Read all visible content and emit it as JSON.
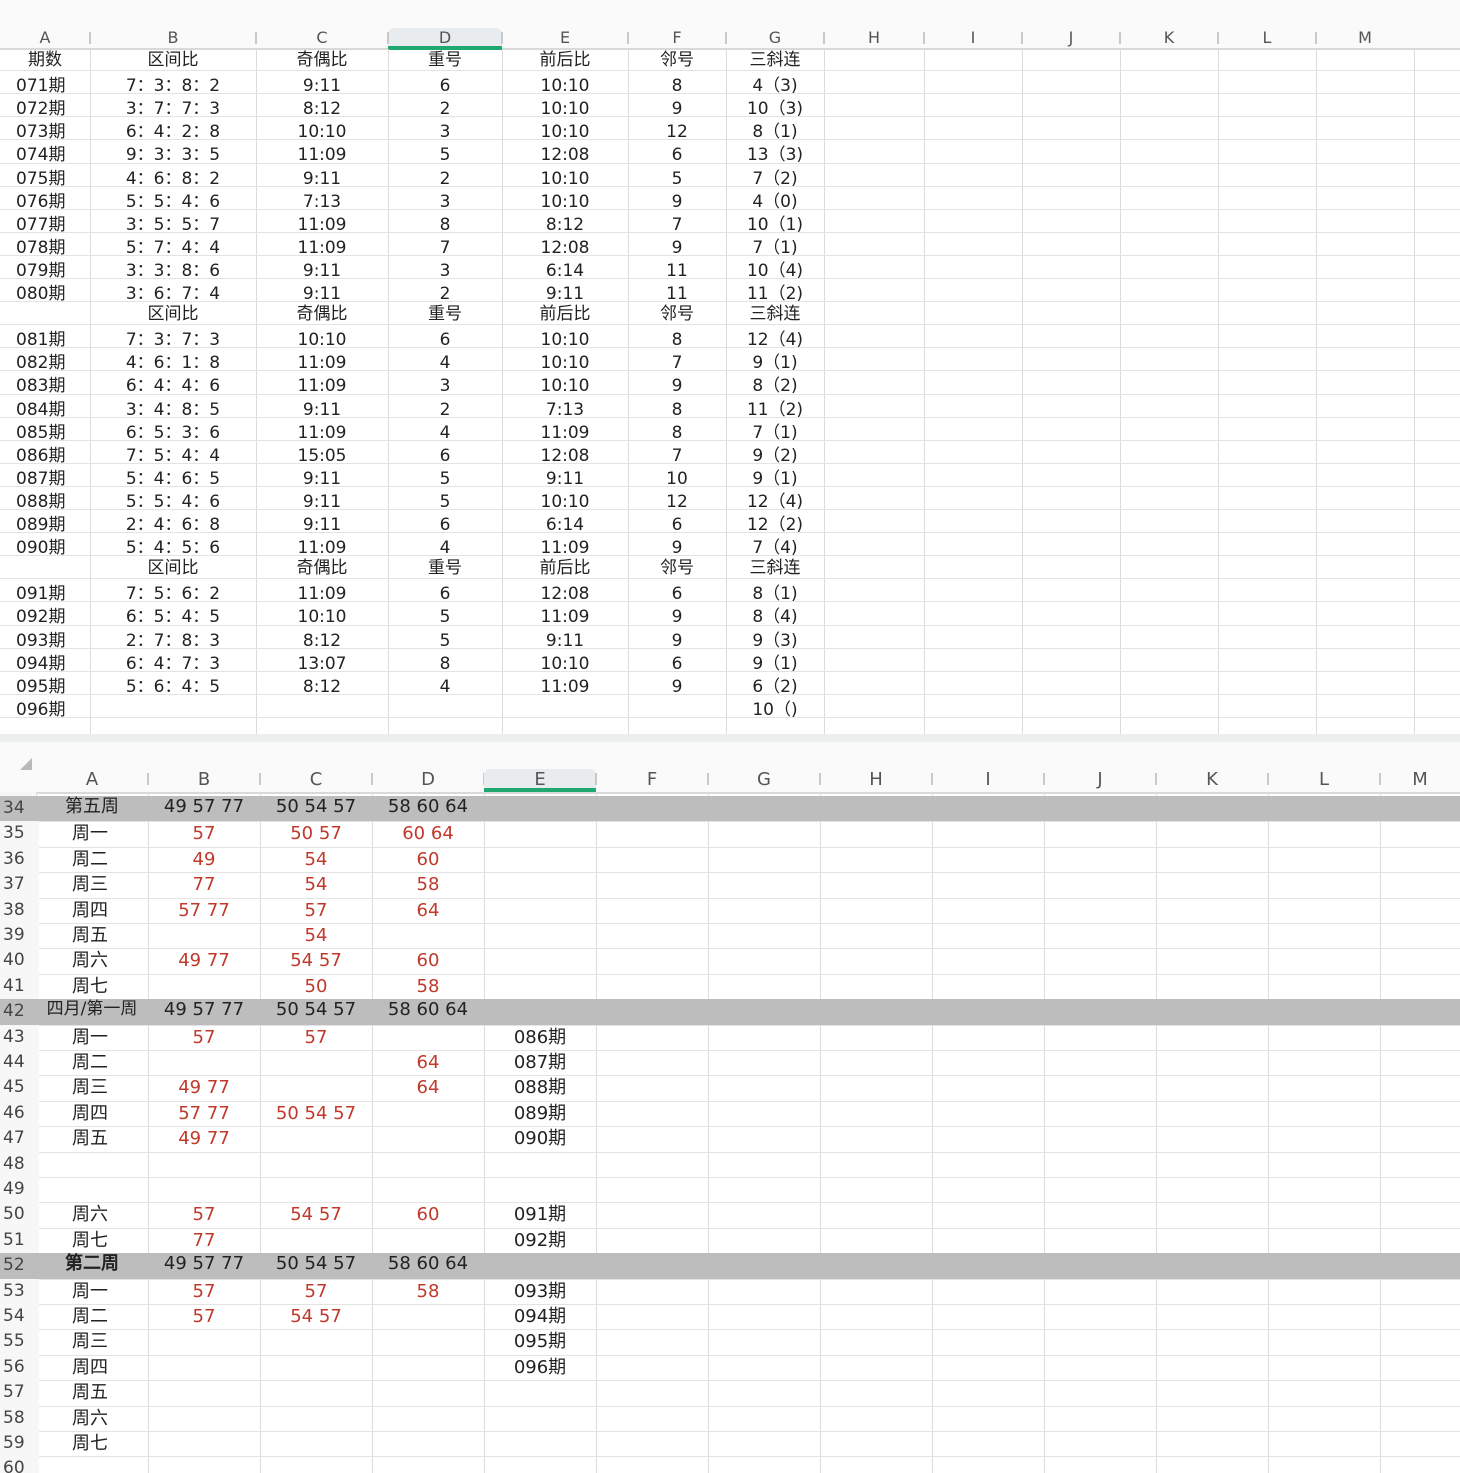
{
  "sheet1": {
    "columns": [
      "A",
      "B",
      "C",
      "D",
      "E",
      "F",
      "G",
      "H",
      "I",
      "J",
      "K",
      "L",
      "M"
    ],
    "selected_column": "D",
    "rows": [
      {
        "type": "header",
        "cells": [
          "期数",
          "区间比",
          "奇偶比",
          "重号",
          "前后比",
          "邻号",
          "三斜连"
        ]
      },
      {
        "cells": [
          "071期",
          "7：3：8：2",
          "9:11",
          "6",
          "10:10",
          "8",
          "4（3)"
        ]
      },
      {
        "cells": [
          "072期",
          "3：7：7：3",
          "8:12",
          "2",
          "10:10",
          "9",
          "10（3)"
        ]
      },
      {
        "cells": [
          "073期",
          "6：4：2：8",
          "10:10",
          "3",
          "10:10",
          "12",
          "8（1)"
        ]
      },
      {
        "cells": [
          "074期",
          "9：3：3：5",
          "11:09",
          "5",
          "12:08",
          "6",
          "13（3)"
        ]
      },
      {
        "cells": [
          "075期",
          "4：6：8：2",
          "9:11",
          "2",
          "10:10",
          "5",
          "7（2)"
        ]
      },
      {
        "cells": [
          "076期",
          "5：5：4：6",
          "7:13",
          "3",
          "10:10",
          "9",
          "4（0)"
        ]
      },
      {
        "cells": [
          "077期",
          "3：5：5：7",
          "11:09",
          "8",
          "8:12",
          "7",
          "10（1)"
        ]
      },
      {
        "cells": [
          "078期",
          "5：7：4：4",
          "11:09",
          "7",
          "12:08",
          "9",
          "7（1)"
        ]
      },
      {
        "cells": [
          "079期",
          "3：3：8：6",
          "9:11",
          "3",
          "6:14",
          "11",
          "10（4)"
        ]
      },
      {
        "cells": [
          "080期",
          "3：6：7：4",
          "9:11",
          "2",
          "9:11",
          "11",
          "11（2)"
        ]
      },
      {
        "type": "header",
        "cells": [
          "",
          "区间比",
          "奇偶比",
          "重号",
          "前后比",
          "邻号",
          "三斜连"
        ]
      },
      {
        "cells": [
          "081期",
          "7：3：7：3",
          "10:10",
          "6",
          "10:10",
          "8",
          "12（4)"
        ]
      },
      {
        "cells": [
          "082期",
          "4：6：1：8",
          "11:09",
          "4",
          "10:10",
          "7",
          "9（1)"
        ]
      },
      {
        "cells": [
          "083期",
          "6：4：4：6",
          "11:09",
          "3",
          "10:10",
          "9",
          "8（2)"
        ]
      },
      {
        "cells": [
          "084期",
          "3：4：8：5",
          "9:11",
          "2",
          "7:13",
          "8",
          "11（2)"
        ]
      },
      {
        "cells": [
          "085期",
          "6：5：3：6",
          "11:09",
          "4",
          "11:09",
          "8",
          "7（1)"
        ]
      },
      {
        "cells": [
          "086期",
          "7：5：4：4",
          "15:05",
          "6",
          "12:08",
          "7",
          "9（2)"
        ]
      },
      {
        "cells": [
          "087期",
          "5：4：6：5",
          "9:11",
          "5",
          "9:11",
          "10",
          "9（1)"
        ]
      },
      {
        "cells": [
          "088期",
          "5：5：4：6",
          "9:11",
          "5",
          "10:10",
          "12",
          "12（4)"
        ]
      },
      {
        "cells": [
          "089期",
          "2：4：6：8",
          "9:11",
          "6",
          "6:14",
          "6",
          "12（2)"
        ]
      },
      {
        "cells": [
          "090期",
          "5：4：5：6",
          "11:09",
          "4",
          "11:09",
          "9",
          "7（4)"
        ]
      },
      {
        "type": "header",
        "cells": [
          "",
          "区间比",
          "奇偶比",
          "重号",
          "前后比",
          "邻号",
          "三斜连"
        ]
      },
      {
        "cells": [
          "091期",
          "7：5：6：2",
          "11:09",
          "6",
          "12:08",
          "6",
          "8（1)"
        ]
      },
      {
        "cells": [
          "092期",
          "6：5：4：5",
          "10:10",
          "5",
          "11:09",
          "9",
          "8（4)"
        ]
      },
      {
        "cells": [
          "093期",
          "2：7：8：3",
          "8:12",
          "5",
          "9:11",
          "9",
          "9（3)"
        ]
      },
      {
        "cells": [
          "094期",
          "6：4：7：3",
          "13:07",
          "8",
          "10:10",
          "6",
          "9（1)"
        ]
      },
      {
        "cells": [
          "095期",
          "5：6：4：5",
          "8:12",
          "4",
          "11:09",
          "9",
          "6（2)"
        ]
      },
      {
        "cells": [
          "096期",
          "",
          "",
          "",
          "",
          "",
          "10（)"
        ]
      }
    ]
  },
  "sheet2": {
    "columns": [
      "A",
      "B",
      "C",
      "D",
      "E",
      "F",
      "G",
      "H",
      "I",
      "J",
      "K",
      "L",
      "M"
    ],
    "selected_column": "E",
    "rows": [
      {
        "n": "34",
        "grey": true,
        "cells": [
          "第五周",
          "49 57 77",
          "50 54 57",
          "58 60 64",
          ""
        ]
      },
      {
        "n": "35",
        "cells": [
          "周一",
          "57",
          "50 57",
          "60 64",
          ""
        ]
      },
      {
        "n": "36",
        "cells": [
          "周二",
          "49",
          "54",
          "60",
          ""
        ]
      },
      {
        "n": "37",
        "cells": [
          "周三",
          "77",
          "54",
          "58",
          ""
        ]
      },
      {
        "n": "38",
        "cells": [
          "周四",
          "57 77",
          "57",
          "64",
          ""
        ]
      },
      {
        "n": "39",
        "cells": [
          "周五",
          "",
          "54",
          "",
          ""
        ]
      },
      {
        "n": "40",
        "cells": [
          "周六",
          "49 77",
          "54 57",
          "60",
          ""
        ]
      },
      {
        "n": "41",
        "cells": [
          "周七",
          "",
          "50",
          "58",
          ""
        ]
      },
      {
        "n": "42",
        "grey": true,
        "cells": [
          "四月/第一周",
          "49 57 77",
          "50 54 57",
          "58 60 64",
          ""
        ]
      },
      {
        "n": "43",
        "cells": [
          "周一",
          "57",
          "57",
          "",
          "086期"
        ]
      },
      {
        "n": "44",
        "cells": [
          "周二",
          "",
          "",
          "64",
          "087期"
        ]
      },
      {
        "n": "45",
        "cells": [
          "周三",
          "49 77",
          "",
          "64",
          "088期"
        ]
      },
      {
        "n": "46",
        "cells": [
          "周四",
          "57 77",
          "50 54 57",
          "",
          "089期"
        ]
      },
      {
        "n": "47",
        "cells": [
          "周五",
          "49 77",
          "",
          "",
          "090期"
        ]
      },
      {
        "n": "48",
        "cells": [
          "",
          "",
          "",
          "",
          ""
        ]
      },
      {
        "n": "49",
        "cells": [
          "",
          "",
          "",
          "",
          ""
        ]
      },
      {
        "n": "50",
        "cells": [
          "周六",
          "57",
          "54 57",
          "60",
          "091期"
        ]
      },
      {
        "n": "51",
        "cells": [
          "周七",
          "77",
          "",
          "",
          "092期"
        ]
      },
      {
        "n": "52",
        "grey": true,
        "boldA": true,
        "cells": [
          "第二周",
          "49 57 77",
          "50 54 57",
          "58 60 64",
          ""
        ]
      },
      {
        "n": "53",
        "cells": [
          "周一",
          "57",
          "57",
          "58",
          "093期"
        ]
      },
      {
        "n": "54",
        "cells": [
          "周二",
          "57",
          "54 57",
          "",
          "094期"
        ]
      },
      {
        "n": "55",
        "cells": [
          "周三",
          "",
          "",
          "",
          "095期"
        ]
      },
      {
        "n": "56",
        "cells": [
          "周四",
          "",
          "",
          "",
          "096期"
        ]
      },
      {
        "n": "57",
        "cells": [
          "周五",
          "",
          "",
          "",
          ""
        ]
      },
      {
        "n": "58",
        "cells": [
          "周六",
          "",
          "",
          "",
          ""
        ]
      },
      {
        "n": "59",
        "cells": [
          "周七",
          "",
          "",
          "",
          ""
        ]
      },
      {
        "n": "60",
        "cells": [
          "",
          "",
          "",
          "",
          ""
        ]
      }
    ]
  }
}
